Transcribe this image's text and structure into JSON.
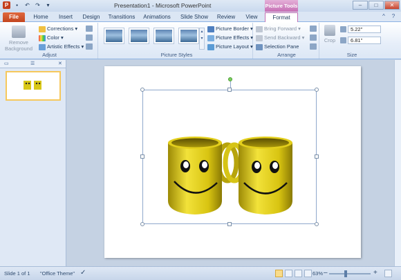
{
  "window": {
    "title": "Presentation1 - Microsoft PowerPoint",
    "context_tab_header": "Picture Tools",
    "app_icon_letter": "P"
  },
  "tabs": [
    "File",
    "Home",
    "Insert",
    "Design",
    "Transitions",
    "Animations",
    "Slide Show",
    "Review",
    "View",
    "Format"
  ],
  "ribbon": {
    "adjust": {
      "remove_background": "Remove Background",
      "corrections": "Corrections ▾",
      "color": "Color ▾",
      "artistic_effects": "Artistic Effects ▾",
      "label": "Adjust"
    },
    "picture_styles": {
      "picture_border": "Picture Border ▾",
      "picture_effects": "Picture Effects ▾",
      "picture_layout": "Picture Layout ▾",
      "label": "Picture Styles"
    },
    "arrange": {
      "bring_forward": "Bring Forward ▾",
      "send_backward": "Send Backward ▾",
      "selection_pane": "Selection Pane",
      "label": "Arrange"
    },
    "size": {
      "crop": "Crop",
      "height": "5.22\"",
      "width": "6.81\"",
      "label": "Size"
    }
  },
  "left_pane": {
    "slide_number": "1"
  },
  "status": {
    "slide_info": "Slide 1 of 1",
    "theme": "\"Office Theme\"",
    "zoom": "63%"
  },
  "colors": {
    "file_tab": "#c3451f",
    "picture_tools": "#c56fb4",
    "mug_yellow": "#e6d21a"
  }
}
